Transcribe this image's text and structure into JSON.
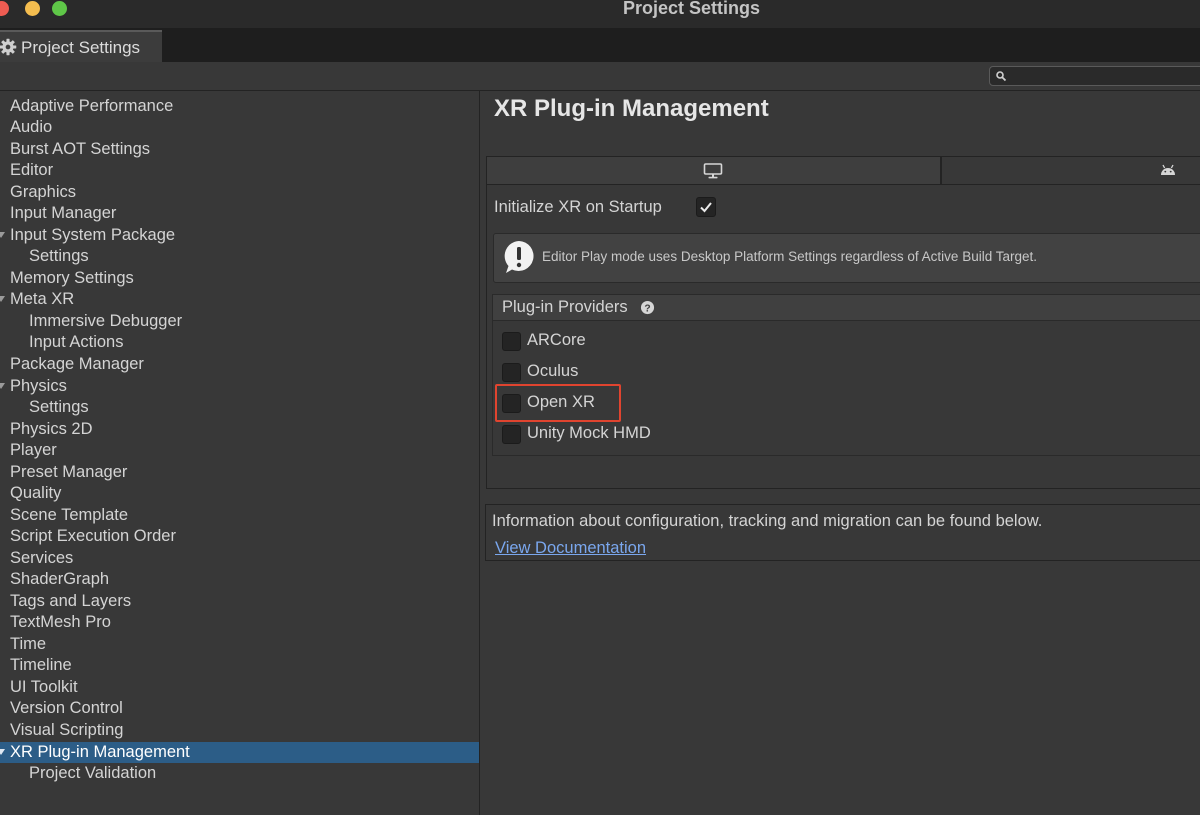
{
  "window": {
    "title": "Project Settings"
  },
  "tab": {
    "label": "Project Settings",
    "icon": "gear-icon"
  },
  "search": {
    "placeholder": "",
    "value": ""
  },
  "sidebar": {
    "items": [
      {
        "label": "Adaptive Performance"
      },
      {
        "label": "Audio"
      },
      {
        "label": "Burst AOT Settings"
      },
      {
        "label": "Editor"
      },
      {
        "label": "Graphics"
      },
      {
        "label": "Input Manager"
      },
      {
        "label": "Input System Package"
      },
      {
        "label": "Settings"
      },
      {
        "label": "Memory Settings"
      },
      {
        "label": "Meta XR"
      },
      {
        "label": "Immersive Debugger"
      },
      {
        "label": "Input Actions"
      },
      {
        "label": "Package Manager"
      },
      {
        "label": "Physics"
      },
      {
        "label": "Settings"
      },
      {
        "label": "Physics 2D"
      },
      {
        "label": "Player"
      },
      {
        "label": "Preset Manager"
      },
      {
        "label": "Quality"
      },
      {
        "label": "Scene Template"
      },
      {
        "label": "Script Execution Order"
      },
      {
        "label": "Services"
      },
      {
        "label": "ShaderGraph"
      },
      {
        "label": "Tags and Layers"
      },
      {
        "label": "TextMesh Pro"
      },
      {
        "label": "Time"
      },
      {
        "label": "Timeline"
      },
      {
        "label": "UI Toolkit"
      },
      {
        "label": "Version Control"
      },
      {
        "label": "Visual Scripting"
      },
      {
        "label": "XR Plug-in Management"
      },
      {
        "label": "Project Validation"
      }
    ],
    "selected": "XR Plug-in Management"
  },
  "main": {
    "title": "XR Plug-in Management",
    "platform_tabs": [
      {
        "name": "Desktop",
        "icon": "monitor-icon",
        "active": true
      },
      {
        "name": "Android",
        "icon": "android-icon",
        "active": false
      }
    ],
    "initialize_xr": {
      "label": "Initialize XR on Startup",
      "checked": true
    },
    "help_message": "Editor Play mode uses Desktop Platform Settings regardless of Active Build Target.",
    "providers": {
      "header": "Plug-in Providers",
      "items": [
        {
          "label": "ARCore",
          "checked": false
        },
        {
          "label": "Oculus",
          "checked": false
        },
        {
          "label": "Open XR",
          "checked": false
        },
        {
          "label": "Unity Mock HMD",
          "checked": false
        }
      ]
    },
    "info_text": "Information about configuration, tracking and migration can be found below.",
    "doc_link": "View Documentation"
  },
  "colors": {
    "selection": "#2c5d87",
    "highlight": "#e0442f",
    "link": "#7aa7ee"
  }
}
